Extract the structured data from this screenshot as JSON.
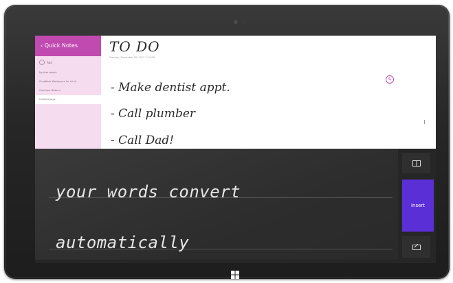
{
  "onenote": {
    "sidebar": {
      "header": "‹ Quick Notes",
      "add_label": "Add",
      "pages": [
        "My first sketch",
        "SnapBook Workspace for all of...",
        "Grandma Maker's",
        "Untitled page"
      ],
      "selected_index": 3
    },
    "note": {
      "title": "TO DO",
      "date": "Tuesday, December 18, 2012    2:15 PM",
      "lines": [
        "- Make dentist appt.",
        "- Call plumber",
        "- Call Dad!"
      ]
    }
  },
  "handwriting_panel": {
    "line1": "your words convert",
    "line2": "automatically",
    "insert_label": "Insert",
    "icons": [
      "keyboard-icon",
      "handwriting-keyboard-icon"
    ]
  },
  "colors": {
    "accent": "#c14ab0",
    "insert": "#5b2fd6"
  }
}
